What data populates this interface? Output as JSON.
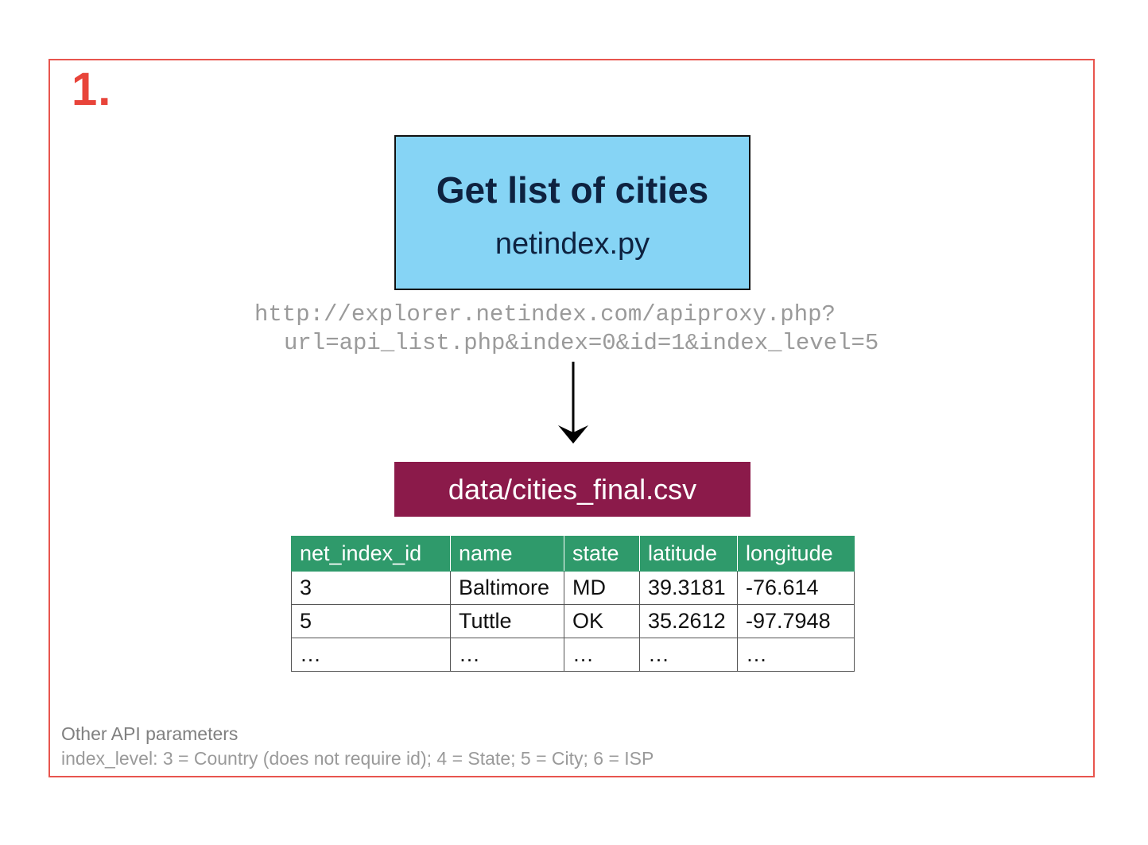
{
  "step": {
    "number": "1."
  },
  "process": {
    "title": "Get list of cities",
    "script": "netindex.py"
  },
  "api": {
    "url_line1": "http://explorer.netindex.com/apiproxy.php?",
    "url_line2": "url=api_list.php&index=0&id=1&index_level=5"
  },
  "output": {
    "file": "data/cities_final.csv"
  },
  "table": {
    "headers": [
      "net_index_id",
      "name",
      "state",
      "latitude",
      "longitude"
    ],
    "rows": [
      [
        "3",
        "Baltimore",
        "MD",
        "39.3181",
        "-76.614"
      ],
      [
        "5",
        "Tuttle",
        "OK",
        "35.2612",
        "-97.7948"
      ],
      [
        "…",
        "…",
        "…",
        "…",
        "…"
      ]
    ]
  },
  "notes": {
    "title": "Other API parameters",
    "text": "index_level: 3 = Country (does not require id); 4 = State; 5 = City; 6 = ISP"
  },
  "colors": {
    "frame": "#e8554e",
    "step_number": "#e8443a",
    "process_box": "#86d4f5",
    "output_box": "#8b1a4a",
    "table_header": "#2f9a6b"
  }
}
